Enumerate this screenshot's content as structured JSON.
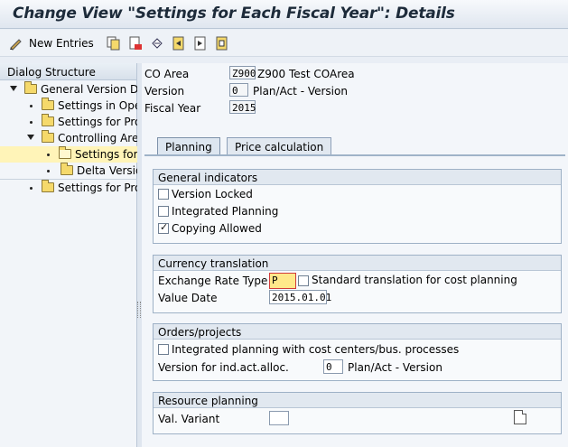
{
  "window": {
    "title": "Change View \"Settings for Each Fiscal Year\": Details"
  },
  "toolbar": {
    "new_entries_label": "New Entries"
  },
  "dialog": {
    "header": "Dialog Structure",
    "items": [
      {
        "label": "General Version Def"
      },
      {
        "label": "Settings in Oper"
      },
      {
        "label": "Settings for Pro"
      },
      {
        "label": "Controlling Area"
      },
      {
        "label": "Settings for"
      },
      {
        "label": "Delta Version"
      },
      {
        "label": "Settings for Pro"
      }
    ]
  },
  "header_fields": {
    "co_area": {
      "label": "CO Area",
      "value": "Z900",
      "desc": "Z900 Test COArea"
    },
    "version": {
      "label": "Version",
      "value": "0",
      "desc": "Plan/Act - Version"
    },
    "fiscal_year": {
      "label": "Fiscal Year",
      "value": "2015"
    }
  },
  "tabs": [
    {
      "label": "Planning"
    },
    {
      "label": "Price calculation"
    }
  ],
  "general_indicators": {
    "title": "General indicators",
    "version_locked": {
      "label": "Version Locked",
      "checked": false
    },
    "integrated_planning": {
      "label": "Integrated Planning",
      "checked": false
    },
    "copying_allowed": {
      "label": "Copying Allowed",
      "checked": true
    }
  },
  "currency_translation": {
    "title": "Currency translation",
    "exchange_rate_type": {
      "label": "Exchange Rate Type",
      "value": "P"
    },
    "standard_translation": {
      "label": "Standard translation for cost planning",
      "checked": false
    },
    "value_date": {
      "label": "Value Date",
      "value": "2015.01.01"
    }
  },
  "orders_projects": {
    "title": "Orders/projects",
    "integrated_planning_cc": {
      "label": "Integrated planning with cost centers/bus. processes",
      "checked": false
    },
    "version_ind_act_alloc": {
      "label": "Version for ind.act.alloc.",
      "value": "0",
      "desc": "Plan/Act - Version"
    }
  },
  "resource_planning": {
    "title": "Resource planning",
    "val_variant": {
      "label": "Val. Variant",
      "value": ""
    }
  },
  "colors": {
    "accent": "#1d2b3a",
    "selected": "#fff4b8",
    "focus": "#ffe88a"
  }
}
